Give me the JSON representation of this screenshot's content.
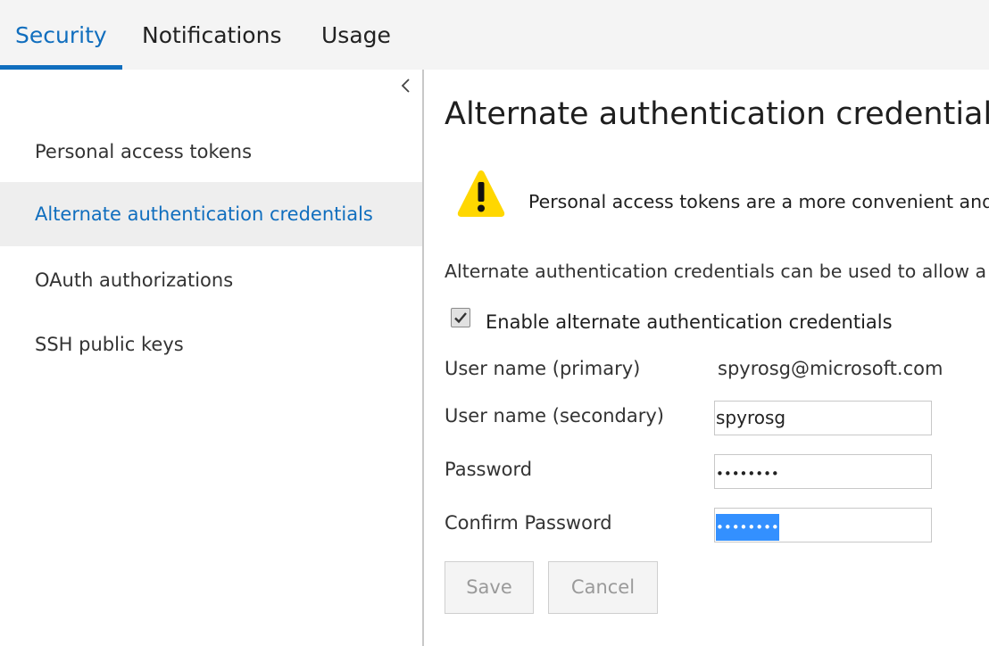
{
  "tabs": [
    {
      "label": "Security",
      "active": true
    },
    {
      "label": "Notifications",
      "active": false
    },
    {
      "label": "Usage",
      "active": false
    }
  ],
  "sidebar": {
    "collapse_icon": "chevron-left-icon",
    "items": [
      {
        "label": "Personal access tokens",
        "selected": false
      },
      {
        "label": "Alternate authentication credentials",
        "selected": true
      },
      {
        "label": "OAuth authorizations",
        "selected": false
      },
      {
        "label": "SSH public keys",
        "selected": false
      }
    ]
  },
  "main": {
    "title": "Alternate authentication credentials",
    "warning": {
      "icon": "warning-triangle-icon",
      "text": "Personal access tokens are a more convenient and"
    },
    "description": "Alternate authentication credentials can be used to allow a",
    "enable_checkbox": {
      "label": "Enable alternate authentication credentials",
      "checked": true
    },
    "form": {
      "primary_label": "User name (primary)",
      "primary_value": "spyrosg@microsoft.com",
      "secondary_label": "User name (secondary)",
      "secondary_value": "spyrosg",
      "password_label": "Password",
      "password_value": "••••••••",
      "confirm_label": "Confirm Password",
      "confirm_value": "••••••••"
    },
    "buttons": {
      "save": "Save",
      "cancel": "Cancel"
    }
  },
  "colors": {
    "accent": "#106ebe",
    "selection": "#3390ff",
    "warning": "#ffd700"
  }
}
